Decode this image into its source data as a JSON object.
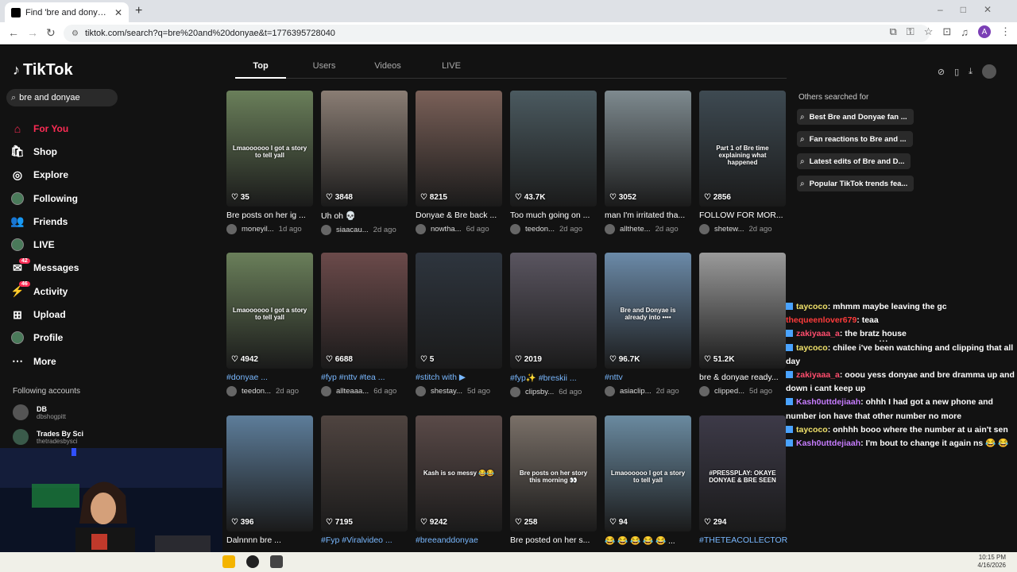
{
  "browser": {
    "tab_title": "Find 'bre and donyae' on TikTok",
    "tab_close": "✕",
    "new_tab": "+",
    "url": "tiktok.com/search?q=bre%20and%20donyae&t=1776395728040"
  },
  "sidebar": {
    "logo": "TikTok",
    "search_value": "bre and donyae",
    "nav": [
      {
        "label": "For You",
        "icon": "home-icon",
        "glyph": "⌂",
        "active": true
      },
      {
        "label": "Shop",
        "icon": "shop-icon",
        "glyph": "🛍"
      },
      {
        "label": "Explore",
        "icon": "compass-icon",
        "glyph": "◎"
      },
      {
        "label": "Following",
        "icon": "following-avatar-icon",
        "glyph": ""
      },
      {
        "label": "Friends",
        "icon": "friends-icon",
        "glyph": "👥"
      },
      {
        "label": "LIVE",
        "icon": "live-avatar-icon",
        "glyph": ""
      },
      {
        "label": "Messages",
        "icon": "messages-icon",
        "glyph": "✉",
        "badge": "42"
      },
      {
        "label": "Activity",
        "icon": "activity-icon",
        "glyph": "⚡",
        "badge": "46"
      },
      {
        "label": "Upload",
        "icon": "upload-icon",
        "glyph": "⊞"
      },
      {
        "label": "Profile",
        "icon": "profile-avatar-icon",
        "glyph": ""
      },
      {
        "label": "More",
        "icon": "more-icon",
        "glyph": "⋯"
      }
    ],
    "following_heading": "Following accounts",
    "following": [
      {
        "name": "DB",
        "handle": "dbshogpitt"
      },
      {
        "name": "Trades By Sci",
        "handle": "thetradesbysci"
      }
    ]
  },
  "tabs": [
    "Top",
    "Users",
    "Videos",
    "LIVE"
  ],
  "videos": [
    {
      "views": "35",
      "caption": "Bre posts on her ig ...",
      "user": "moneyil...",
      "date": "1d ago",
      "overlay": "Lmaoooooo I got a story to tell yall",
      "color": "#6a7f5a"
    },
    {
      "views": "3848",
      "caption": "Uh oh 💀",
      "user": "siaacau...",
      "date": "2d ago",
      "overlay": "",
      "color": "#8a7d74"
    },
    {
      "views": "8215",
      "caption": "Donyae & Bre back ...",
      "user": "nowtha...",
      "date": "6d ago",
      "overlay": "",
      "color": "#7a6058"
    },
    {
      "views": "43.7K",
      "caption": "Too much going on ...",
      "user": "teedon...",
      "date": "2d ago",
      "overlay": "",
      "color": "#4b5a60"
    },
    {
      "views": "3052",
      "caption": "man I'm irritated tha...",
      "user": "allthete...",
      "date": "2d ago",
      "overlay": "",
      "color": "#7e8a8f"
    },
    {
      "views": "2856",
      "caption": "FOLLOW FOR MOR...",
      "user": "shetew...",
      "date": "2d ago",
      "overlay": "Part 1 of Bre time explaining what happened",
      "color": "#3e4a52"
    },
    {
      "views": "4942",
      "caption": "#donyae ...",
      "user": "teedon...",
      "date": "2d ago",
      "overlay": "Lmaoooooo I got a story to tell yall",
      "color": "#6a7f5a",
      "tag": true
    },
    {
      "views": "6688",
      "caption": "#fyp #nttv #tea ...",
      "user": "allteaaa...",
      "date": "6d ago",
      "overlay": "",
      "color": "#6b4a4a",
      "tag": true
    },
    {
      "views": "5",
      "caption": "#stitch with ▶",
      "user": "shestay...",
      "date": "5d ago",
      "overlay": "",
      "color": "#2e353e",
      "tag": true
    },
    {
      "views": "2019",
      "caption": "#fyp✨ #breskii ...",
      "user": "clipsby...",
      "date": "6d ago",
      "overlay": "",
      "color": "#5a5560",
      "tag": true
    },
    {
      "views": "96.7K",
      "caption": "#nttv",
      "user": "asiaclip...",
      "date": "2d ago",
      "overlay": "Bre and Donyae is already into ••••",
      "color": "#6b8aa8",
      "tag": true
    },
    {
      "views": "51.2K",
      "caption": "bre & donyae ready...",
      "user": "clipped...",
      "date": "5d ago",
      "overlay": "",
      "color": "#9a9a9a"
    },
    {
      "views": "396",
      "caption": "Dalnnnn bre ...",
      "user": "",
      "date": "",
      "overlay": "",
      "color": "#5d7d9a"
    },
    {
      "views": "7195",
      "caption": "#Fyp #Viralvideo ...",
      "user": "",
      "date": "",
      "overlay": "",
      "color": "#4f4440",
      "tag": true
    },
    {
      "views": "9242",
      "caption": "#breeanddonyae",
      "user": "",
      "date": "",
      "overlay": "Kash is so messy 😂😂",
      "color": "#5a4a48",
      "tag": true
    },
    {
      "views": "258",
      "caption": "Bre posted on her s...",
      "user": "",
      "date": "",
      "overlay": "Bre posts on her story this morning 👀",
      "color": "#7a7068"
    },
    {
      "views": "94",
      "caption": "😂 😂 😂 😂 😂 ...",
      "user": "",
      "date": "",
      "overlay": "Lmaoooooo I got a story to tell yall",
      "color": "#6a8aa0"
    },
    {
      "views": "294",
      "caption": "#THETEACOLLECTOR",
      "user": "",
      "date": "",
      "overlay": "#PRESSPLAY: OKAYE DONYAE & BRE SEEN",
      "color": "#3d3a48",
      "tag": true
    }
  ],
  "others": {
    "heading": "Others searched for",
    "items": [
      "Best Bre and Donyae fan ...",
      "Fan reactions to Bre and ...",
      "Latest edits of Bre and D...",
      "Popular TikTok trends fea..."
    ]
  },
  "chat_dots": "...",
  "chat": [
    {
      "user": "taycoco",
      "color": "#f2e36b",
      "text": ": mhmm maybe leaving the gc",
      "icon": true
    },
    {
      "user": "thequeenlover679",
      "color": "#ff3b3b",
      "text": ": teaa",
      "icon": false
    },
    {
      "user": "zakiyaaa_a",
      "color": "#ff4d6d",
      "text": ": the bratz house",
      "icon": true
    },
    {
      "user": "taycoco",
      "color": "#f2e36b",
      "text": ": chilee i've been watching and clipping that all day",
      "icon": true
    },
    {
      "user": "zakiyaaa_a",
      "color": "#ff4d6d",
      "text": ": ooou yess donyae and bre dramma up and down i cant keep up",
      "icon": true
    },
    {
      "user": "Kash0uttdejiaah",
      "color": "#c77dff",
      "text": ": ohhh I had got a new phone and number ion have that other number no more",
      "icon": true
    },
    {
      "user": "taycoco",
      "color": "#f2e36b",
      "text": ": onhhh booo where the number at u ain't sen",
      "icon": true
    },
    {
      "user": "Kash0uttdejiaah",
      "color": "#c77dff",
      "text": ": I'm bout to change it again ns 😂 😂",
      "icon": true
    }
  ],
  "clock": {
    "time": "10:15 PM",
    "date": "4/16/2026"
  }
}
